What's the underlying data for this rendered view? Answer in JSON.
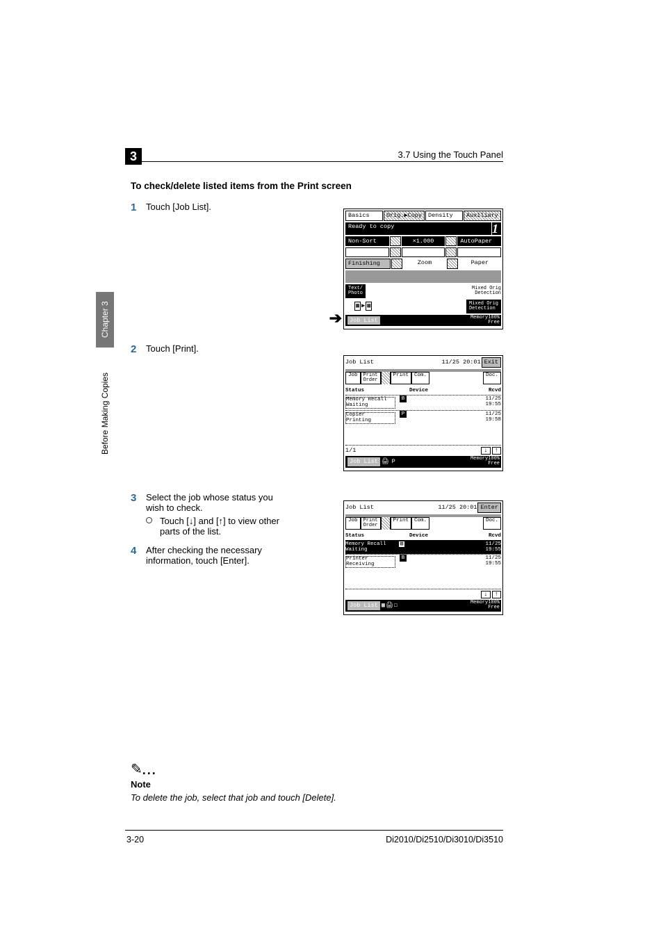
{
  "header": {
    "chapter_number": "3",
    "right_text": "3.7 Using the Touch Panel"
  },
  "side_tab": {
    "dark": "Chapter 3",
    "light": "Before Making Copies"
  },
  "section_title": "To check/delete listed items from the Print screen",
  "steps": {
    "s1": {
      "num": "1",
      "text": "Touch [Job List]."
    },
    "s2": {
      "num": "2",
      "text": "Touch [Print]."
    },
    "s3": {
      "num": "3",
      "text": "Select the job whose status you wish to check.",
      "sub": "Touch [↓] and [↑] to view other parts of the list."
    },
    "s4": {
      "num": "4",
      "text": "After checking the necessary information, touch [Enter]."
    }
  },
  "note": {
    "label": "Note",
    "text": "To delete the job, select that job and touch [Delete]."
  },
  "screens": {
    "basics": {
      "tabs": {
        "basics": "Basics",
        "orig": "Orig.▶Copy",
        "density": "Density",
        "aux": "Auxiliary"
      },
      "status": "Ready to copy",
      "counter": "1",
      "btn1": "Non-Sort",
      "btn2": "×1.000",
      "btn3": "AutoPaper",
      "row2a": "Finishing",
      "row2b": "Zoom",
      "row2c": "Paper",
      "textphoto": "Text/\nPhoto",
      "mixed": "Mixed Orig\nDetection",
      "joblist": "Job List",
      "mem": "Memory100%",
      "mem_label": "Free"
    },
    "list2": {
      "title": "Job List",
      "time": "11/25 20:01",
      "action": "Exit",
      "tabs": {
        "job": "Job",
        "order": "Print\nOrder",
        "print": "Print",
        "com": "Com.",
        "doc": "Doc."
      },
      "head": {
        "status": "Status",
        "device": "Device",
        "rcvd": "Rcvd"
      },
      "rows": [
        {
          "status": "Memory Recall\nWaiting",
          "ic": "B",
          "device": "",
          "rcvd": "11/25\n19:55"
        },
        {
          "status": "Copier\nPrinting",
          "ic": "P",
          "device": "",
          "rcvd": "11/25\n19:58"
        }
      ],
      "page": "1/1",
      "joblist_btn": "Job List",
      "mem": "Memory100%",
      "mem_label": "Free"
    },
    "list3": {
      "title": "Job List",
      "time": "11/25 20:01",
      "action": "Enter",
      "tabs": {
        "job": "Job",
        "order": "Print\nOrder",
        "print": "Print",
        "com": "Com.",
        "doc": "Doc."
      },
      "head": {
        "status": "Status",
        "device": "Device",
        "rcvd": "Rcvd"
      },
      "rows": [
        {
          "status": "Memory Recall\nWaiting",
          "ic": "▧",
          "device": "",
          "rcvd": "11/25\n19:55"
        },
        {
          "status": "Printer\nReceiving",
          "ic": "B",
          "device": "",
          "rcvd": "11/25\n19:55"
        }
      ],
      "joblist_btn": "Job List",
      "mem": "Memory100%",
      "mem_label": "Free"
    }
  },
  "footer": {
    "left": "3-20",
    "right": "Di2010/Di2510/Di3010/Di3510"
  }
}
